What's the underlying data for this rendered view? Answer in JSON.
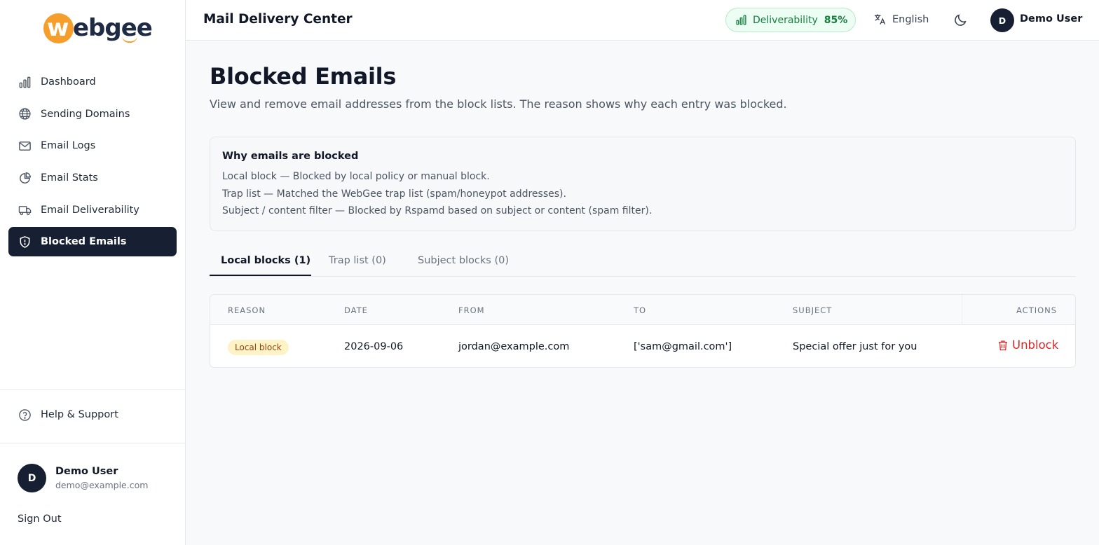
{
  "brand": {
    "logo_w": "w",
    "logo_rest": "ebgee"
  },
  "sidebar": {
    "items": [
      {
        "label": "Dashboard",
        "icon": "bar-chart-icon"
      },
      {
        "label": "Sending Domains",
        "icon": "globe-icon"
      },
      {
        "label": "Email Logs",
        "icon": "mail-icon"
      },
      {
        "label": "Email Stats",
        "icon": "pie-chart-icon"
      },
      {
        "label": "Email Deliverability",
        "icon": "truck-icon"
      },
      {
        "label": "Blocked Emails",
        "icon": "shield-icon",
        "active": true
      }
    ],
    "help_label": "Help & Support",
    "user": {
      "avatar": "D",
      "name": "Demo User",
      "email": "demo@example.com"
    },
    "sign_out": "Sign Out"
  },
  "header": {
    "title": "Mail Delivery Center",
    "deliverability_label": "Deliverability",
    "deliverability_value": "85%",
    "language": "English",
    "user_avatar": "D",
    "user_name": "Demo User"
  },
  "main": {
    "title": "Blocked Emails",
    "subtitle": "View and remove email addresses from the block lists. The reason shows why each entry was blocked.",
    "info": {
      "title": "Why emails are blocked",
      "lines": [
        "Local block — Blocked by local policy or manual block.",
        "Trap list — Matched the WebGee trap list (spam/honeypot addresses).",
        "Subject / content filter — Blocked by Rspamd based on subject or content (spam filter)."
      ]
    },
    "tabs": [
      {
        "label": "Local blocks (1)",
        "active": true
      },
      {
        "label": "Trap list (0)"
      },
      {
        "label": "Subject blocks (0)"
      }
    ],
    "table": {
      "columns": [
        "REASON",
        "DATE",
        "FROM",
        "TO",
        "SUBJECT",
        "ACTIONS"
      ],
      "rows": [
        {
          "reason": "Local block",
          "date": "2026-09-06",
          "from": "jordan@example.com",
          "to": "['sam@gmail.com']",
          "subject": "Special offer just for you",
          "action": "Unblock"
        }
      ]
    }
  },
  "colors": {
    "sidebar_active_bg": "#172033",
    "brand_orange": "#f59e2b",
    "deliverability_green": "#15803d",
    "danger_red": "#dc2626",
    "badge_bg": "#fdf3c7"
  }
}
